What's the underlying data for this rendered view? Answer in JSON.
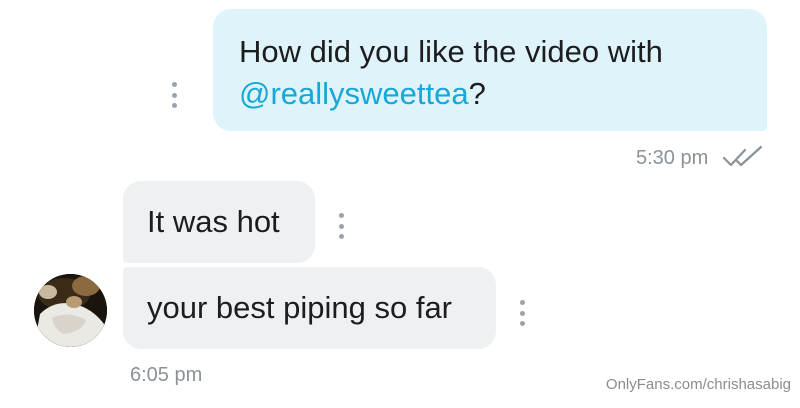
{
  "conversation": {
    "sent_message": {
      "text_before": "How did you like the video with",
      "mention": "@reallysweettea",
      "text_after": "?",
      "time": "5:30 pm",
      "status_icon": "double-check-icon"
    },
    "received_messages": [
      {
        "text": "It was hot"
      },
      {
        "text": "your best piping so far"
      }
    ],
    "received_time": "6:05 pm",
    "options_icon": "kebab-menu-icon"
  },
  "watermark": "OnlyFans.com/chrishasabig",
  "colors": {
    "sent_bubble": "#def4fa",
    "received_bubble": "#eef0f2",
    "mention": "#18a7d8",
    "timestamp": "#8a9299"
  }
}
